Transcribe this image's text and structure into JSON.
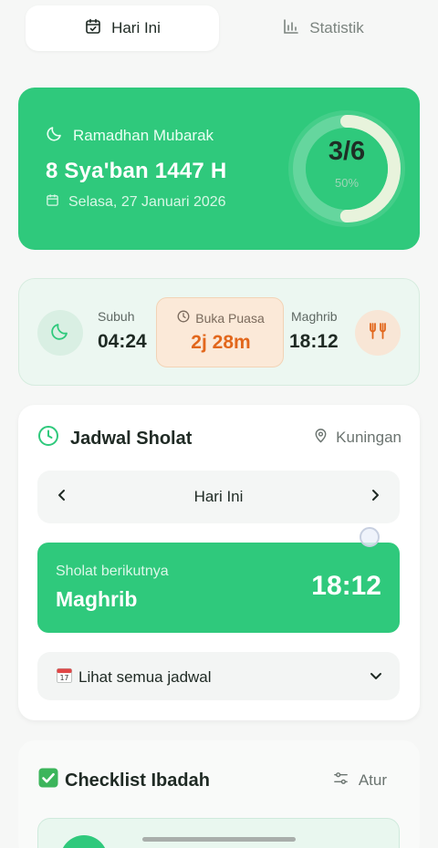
{
  "tabs": {
    "today": "Hari Ini",
    "stats": "Statistik"
  },
  "hero": {
    "greeting": "Ramadhan Mubarak",
    "hijri_date": "8 Sya'ban 1447 H",
    "gregorian_date": "Selasa, 27 Januari 2026",
    "progress_count": "3/6",
    "progress_percent": "50%",
    "progress_fraction": 0.5
  },
  "times": {
    "subuh_label": "Subuh",
    "subuh_time": "04:24",
    "buka_label": "Buka Puasa",
    "buka_value": "2j 28m",
    "maghrib_label": "Maghrib",
    "maghrib_time": "18:12"
  },
  "schedule": {
    "title": "Jadwal Sholat",
    "location": "Kuningan",
    "day_label": "Hari Ini",
    "next_label": "Sholat berikutnya",
    "next_name": "Maghrib",
    "next_time": "18:12",
    "see_all": "Lihat semua jadwal"
  },
  "checklist": {
    "title": "Checklist Ibadah",
    "settings_label": "Atur"
  },
  "colors": {
    "primary_green": "#2fc97c",
    "accent_orange": "#e2671c"
  }
}
